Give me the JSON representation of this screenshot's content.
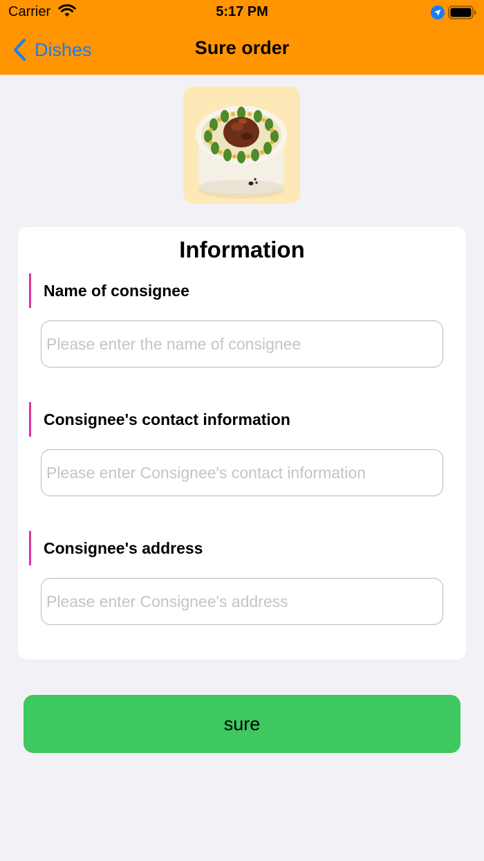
{
  "status_bar": {
    "carrier": "Carrier",
    "time": "5:17 PM",
    "icons": [
      "wifi-icon",
      "location-arrow-icon",
      "battery-icon"
    ]
  },
  "nav": {
    "back_label": "Dishes",
    "title": "Sure order",
    "background": "#ff9500",
    "accent": "#1a7cf5"
  },
  "dish": {
    "image": "dish-photo"
  },
  "form": {
    "title": "Information",
    "sections": [
      {
        "label": "Name of consignee",
        "placeholder": "Please enter the name of consignee",
        "value": ""
      },
      {
        "label": "Consignee's contact information",
        "placeholder": "Please enter Consignee's contact information",
        "value": ""
      },
      {
        "label": "Consignee's address",
        "placeholder": "Please enter Consignee's address",
        "value": ""
      }
    ],
    "marker_color": "#d9359e"
  },
  "submit": {
    "label": "sure",
    "color": "#3ec860"
  }
}
